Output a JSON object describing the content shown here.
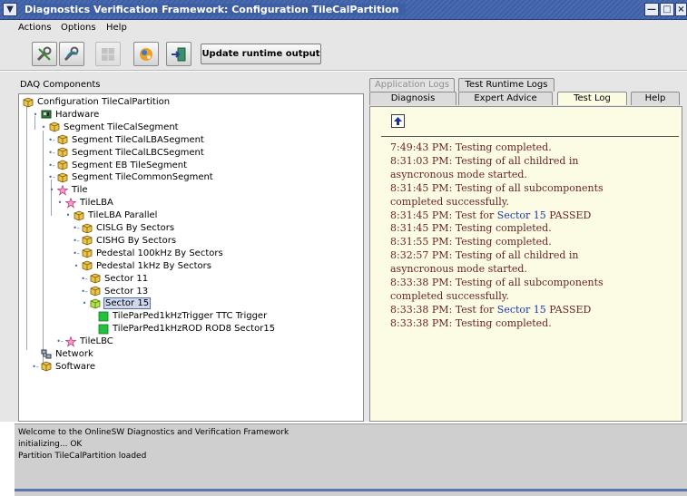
{
  "window": {
    "title": "Diagnostics Verification Framework: Configuration TileCalPartition",
    "controls": [
      "minimize",
      "maximize",
      "close"
    ]
  },
  "menubar": {
    "items": [
      "Actions",
      "Options",
      "Help"
    ]
  },
  "toolbar": {
    "icons": [
      "wrench-check-icon",
      "wrench-reset-icon",
      "grid-icon",
      "gear-ball-icon",
      "exit-door-icon"
    ],
    "update_label": "Update runtime output"
  },
  "left_panel": {
    "header": "DAQ Components",
    "tree": [
      {
        "label": "Configuration TileCalPartition",
        "icon": "box-icon",
        "depth": 0
      },
      {
        "label": "Hardware",
        "icon": "board-icon",
        "depth": 1
      },
      {
        "label": "Segment TileCalSegment",
        "icon": "box-icon",
        "depth": 2
      },
      {
        "label": "Segment TileCalLBASegment",
        "icon": "box-icon",
        "depth": 3
      },
      {
        "label": "Segment TileCalLBCSegment",
        "icon": "box-icon",
        "depth": 3
      },
      {
        "label": "Segment EB TileSegment",
        "icon": "box-icon",
        "depth": 3
      },
      {
        "label": "Segment TileCommonSegment",
        "icon": "box-icon",
        "depth": 3
      },
      {
        "label": "Tile",
        "icon": "star-icon",
        "depth": 3
      },
      {
        "label": "TileLBA",
        "icon": "star-icon",
        "depth": 4
      },
      {
        "label": "TileLBA Parallel",
        "icon": "box-icon",
        "depth": 5
      },
      {
        "label": "CISLG By Sectors",
        "icon": "box-icon",
        "depth": 6
      },
      {
        "label": "CISHG By Sectors",
        "icon": "box-icon",
        "depth": 6
      },
      {
        "label": "Pedestal 100kHz By Sectors",
        "icon": "box-icon",
        "depth": 6
      },
      {
        "label": "Pedestal 1kHz By Sectors",
        "icon": "box-icon",
        "depth": 6
      },
      {
        "label": "Sector 11",
        "icon": "box-icon",
        "depth": 7
      },
      {
        "label": "Sector 13",
        "icon": "box-icon",
        "depth": 7
      },
      {
        "label": "Sector 15",
        "icon": "box-green-icon",
        "depth": 7
      },
      {
        "label": "TileParPed1kHzTrigger TTC Trigger",
        "icon": "green-square-icon",
        "depth": 8
      },
      {
        "label": "TileParPed1kHzROD ROD8 Sector15",
        "icon": "green-square-icon",
        "depth": 8
      },
      {
        "label": "TileLBC",
        "icon": "star-icon",
        "depth": 4
      },
      {
        "label": "Network",
        "icon": "network-icon",
        "depth": 1
      },
      {
        "label": "Software",
        "icon": "box-icon",
        "depth": 1
      }
    ]
  },
  "right_panel": {
    "tabs_top": [
      {
        "label": "Application Logs",
        "state": "disabled"
      },
      {
        "label": "Test Runtime Logs",
        "state": "normal"
      }
    ],
    "tabs_bottom": [
      {
        "label": "Diagnosis",
        "state": "normal"
      },
      {
        "label": "Expert Advice",
        "state": "normal"
      },
      {
        "label": "Test Log",
        "state": "active"
      },
      {
        "label": "Help",
        "state": "normal"
      }
    ],
    "log_lines": [
      [
        "7:49:43 PM: Testing completed."
      ],
      [
        "8:31:03 PM: Testing of all childred in"
      ],
      [
        "asyncronous mode started."
      ],
      [
        "8:31:45 PM: Testing of all subcomponents"
      ],
      [
        "completed successfully."
      ],
      [
        "8:31:45 PM: Test for ",
        "Sector 15",
        " PASSED"
      ],
      [
        "8:31:45 PM: Testing completed."
      ],
      [
        "8:31:55 PM: Testing completed."
      ],
      [
        "8:32:57 PM: Testing of all childred in"
      ],
      [
        "asyncronous mode started."
      ],
      [
        "8:33:38 PM: Testing of all subcomponents"
      ],
      [
        "completed successfully."
      ],
      [
        "8:33:38 PM: Test for ",
        "Sector 15",
        " PASSED"
      ],
      [
        "8:33:38 PM: Testing completed."
      ]
    ]
  },
  "status": {
    "lines": [
      "Welcome to the OnlineSW Diagnostics and Verification Framework",
      "initializing... OK",
      "Partition TileCalPartition loaded"
    ]
  },
  "colors": {
    "titlebar": "#4a6bb0",
    "log_text": "#6b1f1f",
    "log_highlight": "#1a35b0",
    "log_background": "#fcfce4",
    "selection": "#cfd8ec"
  }
}
